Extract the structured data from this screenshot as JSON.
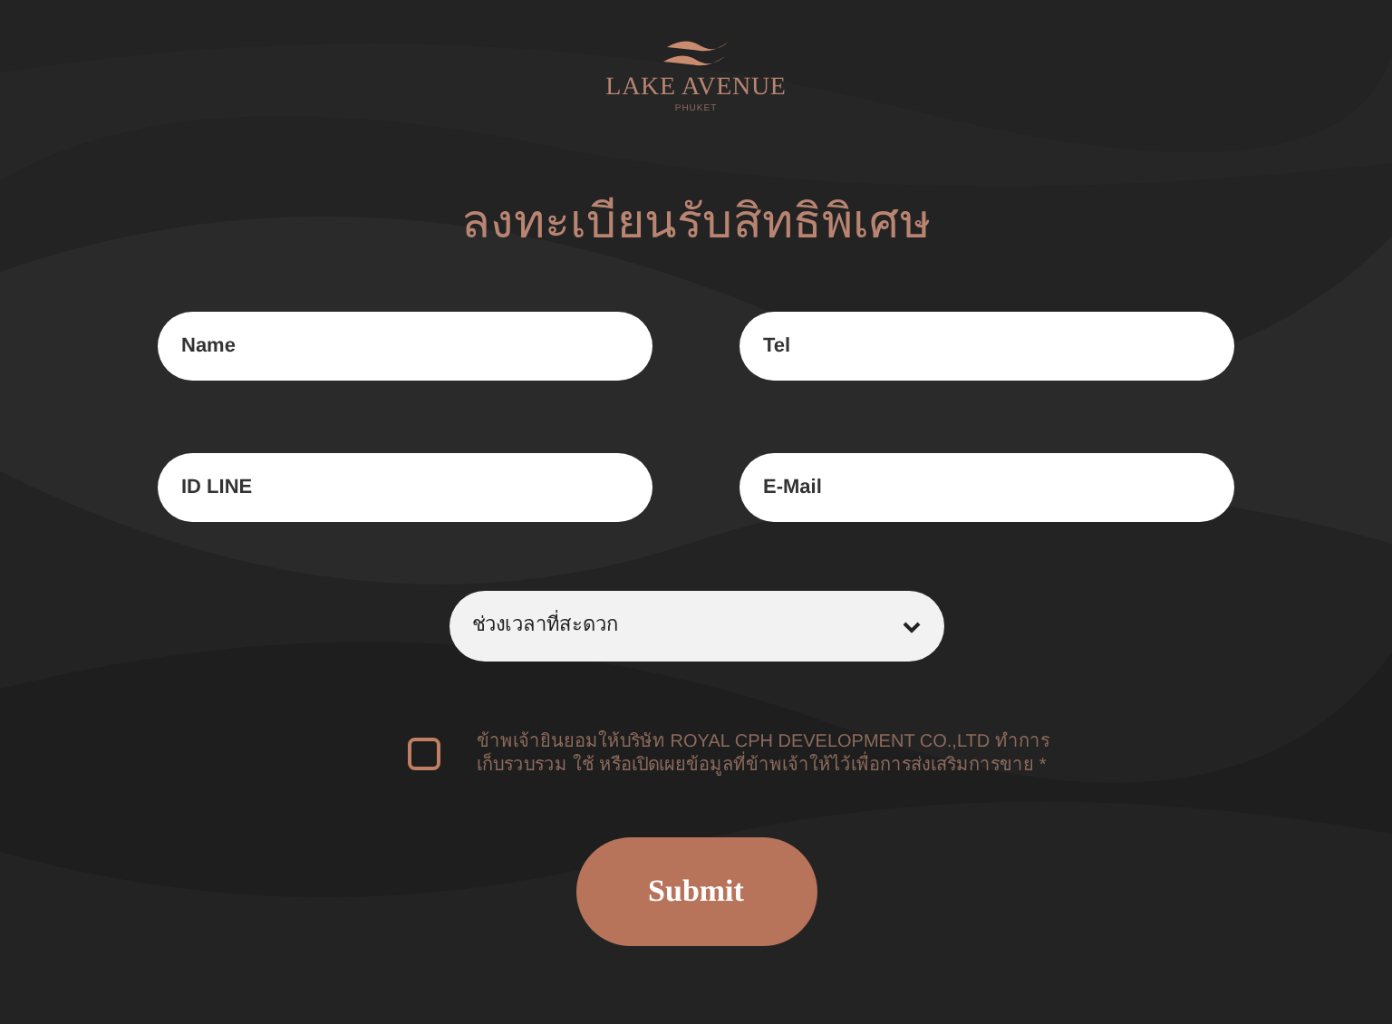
{
  "logo": {
    "name": "LAKE AVENUE",
    "sub": "PHUKET"
  },
  "heading": "ลงทะเบียนรับสิทธิพิเศษ",
  "fields": [
    {
      "placeholder": "Name"
    },
    {
      "placeholder": "Tel"
    },
    {
      "placeholder": "ID LINE"
    },
    {
      "placeholder": "E-Mail"
    }
  ],
  "select": {
    "value": "ช่วงเวลาที่สะดวก"
  },
  "consent": {
    "checked": false,
    "text": "ข้าพเจ้ายินยอมให้บริษัท  ROYAL CPH DEVELOPMENT CO.,LTD ทำการเก็บรวบรวม ใช้ หรือเปิดเผยข้อมูลที่ข้าพเจ้าให้ไว้เพื่อการส่งเสริมการขาย *"
  },
  "submit": "Submit"
}
